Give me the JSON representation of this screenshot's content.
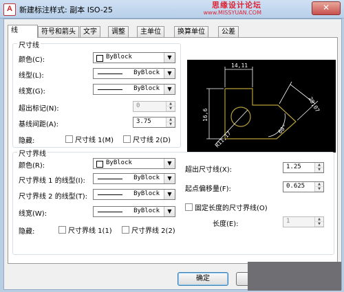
{
  "window": {
    "title": "新建标注样式: 副本 ISO-25",
    "app_icon": "A",
    "close_glyph": "✕",
    "watermark_line1": "思缘设计论坛",
    "watermark_line2": "www.MISSYUAN.COM"
  },
  "tabs": [
    {
      "label": "线",
      "active": true
    },
    {
      "label": "符号和箭头",
      "active": false
    },
    {
      "label": "文字",
      "active": false
    },
    {
      "label": "调整",
      "active": false
    },
    {
      "label": "主单位",
      "active": false
    },
    {
      "label": "换算单位",
      "active": false
    },
    {
      "label": "公差",
      "active": false
    }
  ],
  "dim_lines": {
    "group_title": "尺寸线",
    "color_label": "颜色(C):",
    "color_value": "ByBlock",
    "linetype_label": "线型(L):",
    "linetype_value": "ByBlock",
    "lineweight_label": "线宽(G):",
    "lineweight_value": "ByBlock",
    "extend_ticks_label": "超出标记(N):",
    "extend_ticks_value": "0",
    "baseline_spacing_label": "基线间距(A):",
    "baseline_spacing_value": "3.75",
    "suppress_label": "隐藏:",
    "suppress_dim1": "尺寸线 1(M)",
    "suppress_dim2": "尺寸线 2(D)"
  },
  "ext_lines": {
    "group_title": "尺寸界线",
    "color_label": "颜色(R):",
    "color_value": "ByBlock",
    "linetype1_label": "尺寸界线 1 的线型(I):",
    "linetype1_value": "ByBlock",
    "linetype2_label": "尺寸界线 2 的线型(T):",
    "linetype2_value": "ByBlock",
    "lineweight_label": "线宽(W):",
    "lineweight_value": "ByBlock",
    "suppress_label": "隐藏:",
    "suppress_ext1": "尺寸界线 1(1)",
    "suppress_ext2": "尺寸界线 2(2)",
    "extend_beyond_label": "超出尺寸线(X):",
    "extend_beyond_value": "1.25",
    "offset_label": "起点偏移量(F):",
    "offset_value": "0.625",
    "fixed_length_label": "固定长度的尺寸界线(O)",
    "length_label": "长度(E):",
    "length_value": "1"
  },
  "preview": {
    "dim_top": "14,11",
    "dim_left": "16,6",
    "dim_right": "28,07",
    "dim_angle": "60°",
    "dim_radius": "R11,17"
  },
  "buttons": {
    "ok": "确定"
  },
  "colors": {
    "preview_bg": "#000000",
    "preview_geometry": "#b8a03a",
    "preview_dims": "#ffffff",
    "close_button": "#c75050"
  }
}
